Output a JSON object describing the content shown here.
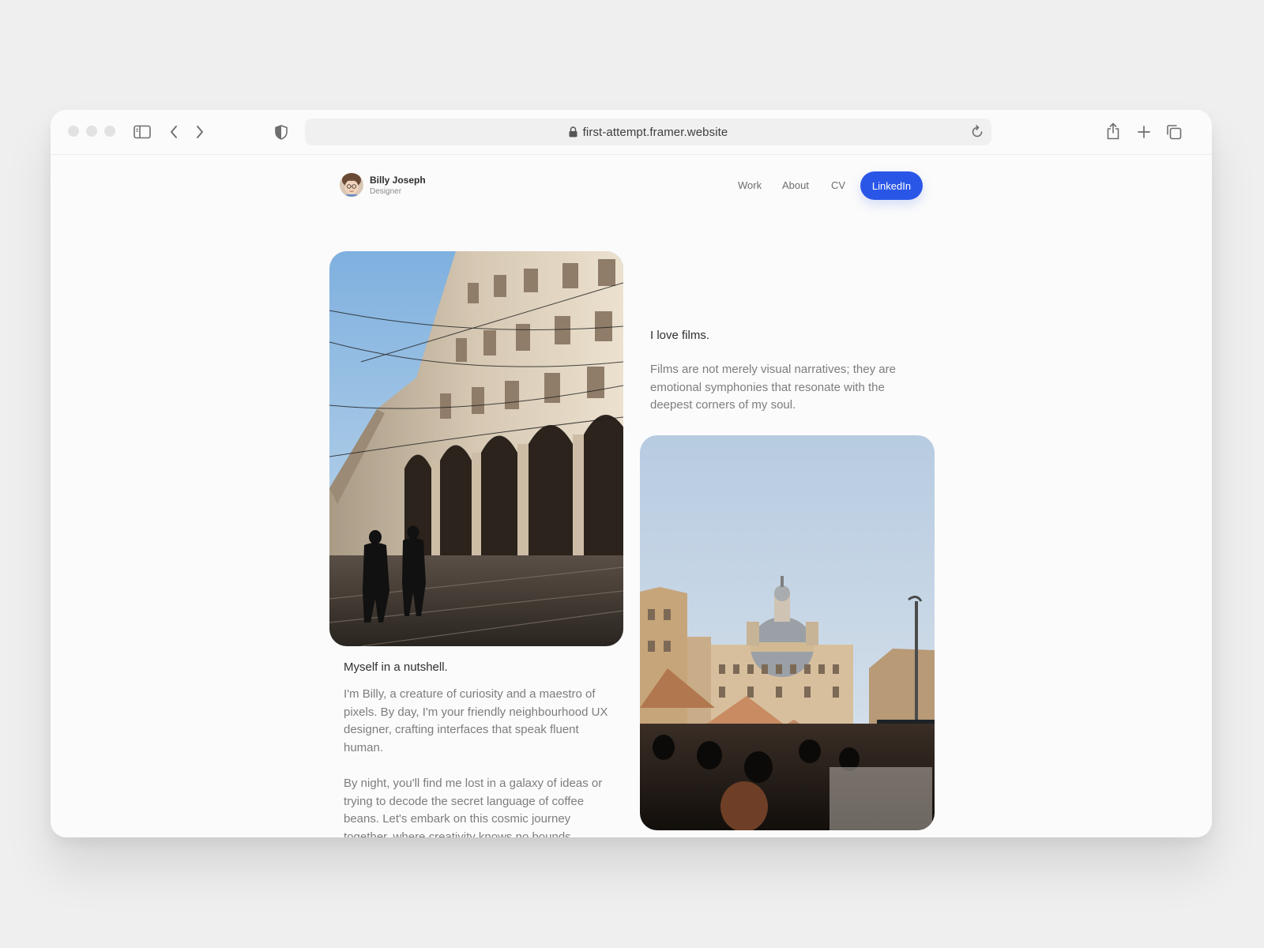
{
  "browser": {
    "url": "first-attempt.framer.website"
  },
  "icons": {
    "sidebar": "sidebar-toggle-icon",
    "back": "chevron-left-icon",
    "forward": "chevron-right-icon",
    "privacy": "shield-icon",
    "lock": "lock-icon",
    "reload": "reload-icon",
    "share": "share-icon",
    "new_tab": "plus-icon",
    "tabs": "tabs-overview-icon"
  },
  "profile": {
    "name": "Billy Joseph",
    "role": "Designer"
  },
  "nav": {
    "items": [
      {
        "label": "Work"
      },
      {
        "label": "About"
      },
      {
        "label": "CV"
      }
    ],
    "cta_label": "LinkedIn"
  },
  "colors": {
    "accent": "#2a56e8",
    "page_bg": "#fbfbfb",
    "outer_bg": "#efefef"
  },
  "sections": {
    "films": {
      "heading": "I love films.",
      "body": "Films are not merely visual narratives; they are emotional symphonies that resonate with the deepest corners of my soul."
    },
    "about": {
      "heading": "Myself in a nutshell.",
      "paragraph1": "I'm Billy, a creature of curiosity and a maestro of pixels. By day, I'm your friendly neighbourhood UX designer, crafting interfaces that speak fluent human.",
      "paragraph2": "By night, you'll find me lost in a galaxy of ideas or trying to decode the secret language of coffee beans. Let's embark on this cosmic journey together, where creativity knows no bounds."
    }
  }
}
